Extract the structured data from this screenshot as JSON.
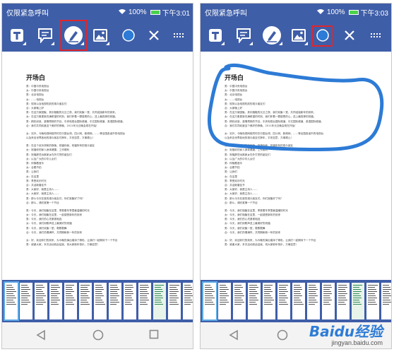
{
  "panels": [
    {
      "id": "before",
      "status": {
        "carrier": "仅限紧急呼叫",
        "battery": "100%",
        "time": "下午3:01"
      },
      "highlighted_tool": "pen-tool"
    },
    {
      "id": "after",
      "status": {
        "carrier": "仅限紧急呼叫",
        "battery": "100%",
        "time": "下午3:03"
      },
      "highlighted_tool": "color-picker",
      "annotation": "blue-ink-circle"
    }
  ],
  "toolbar_icons": [
    "text-tool-icon",
    "comment-tool-icon",
    "pen-tool-icon",
    "image-tool-icon",
    "color-picker-icon",
    "close-icon",
    "more-icon"
  ],
  "document": {
    "title": "开场白",
    "lines": [
      "男：中国中央电视台",
      "女：中国中央电视台",
      "男：北京电视台",
      "女：……电视台",
      "男：现场以及电视机前的观众朋友们",
      "合：大家晚上好",
      "男：在这万家团聚、其乐融融的元旦之夜，我们欢聚一堂，共同迎接新年的到来。",
      "女：在这万象更新充满希望的时刻，我们怀着一颗感恩的心，送上最真挚的祝福。",
      "男：精彩纷呈、激情昂扬的节目，中央电视台国际频道、中文国际频道、英语国际频道。",
      "合：我们共同欢度这个美好的夜晚，2011年元旦晚会现在开始！",
      "",
      "女：另外，今晚电视网络同时在中国台湾，四川网，新闻网，……等全国各省市的电视台",
      "以及来自世界各地的观众朋友们拜年，平安如意，万事顺心！",
      "",
      "男：在这个欢乐祥和的夜晚，祝福你我，祝福所有的观众朋友",
      "女：祝福你的家人身体健康，工作顺利",
      "男：祝福那些远离家乡在外打拼的朋友们",
      "女：以及广大的中华儿女们",
      "男：伴随着音乐",
      "女：合着节拍",
      "男：让我们",
      "女：在这里",
      "男：享受欢乐时光",
      "合：共迎新春佳节",
      "男：大家好，我是主持人……",
      "女：大家好，我是主持人……",
      "男：那么今天在座的观众朋友们，你们准备好了吗？",
      "合：那么，请欣赏第一个节目",
      "",
      "男：今天，我们相聚在这里，享受着冬季里最温暖的时光",
      "女：今天，我们相聚在这里，一起感受新年的到来",
      "男：今天，我们的心灵紧紧相连",
      "女：今天，我们用歌声送上最美好的祝福",
      "男：今天，我们欢聚一堂，载歌载舞",
      "合：今天，我们热情满怀，共同期盼新一年的到来",
      "",
      "女：好，欢迎你们的到来，为今晚的演出增添了精彩。让我们一起期待下一个节目",
      "男：谢谢大家，本次活动到此结束，祝大家新年快乐，万事如意！"
    ]
  },
  "thumbnails_count": 13,
  "watermark": {
    "brand": "Baidu经验",
    "url": "jingyan.baidu.com"
  }
}
